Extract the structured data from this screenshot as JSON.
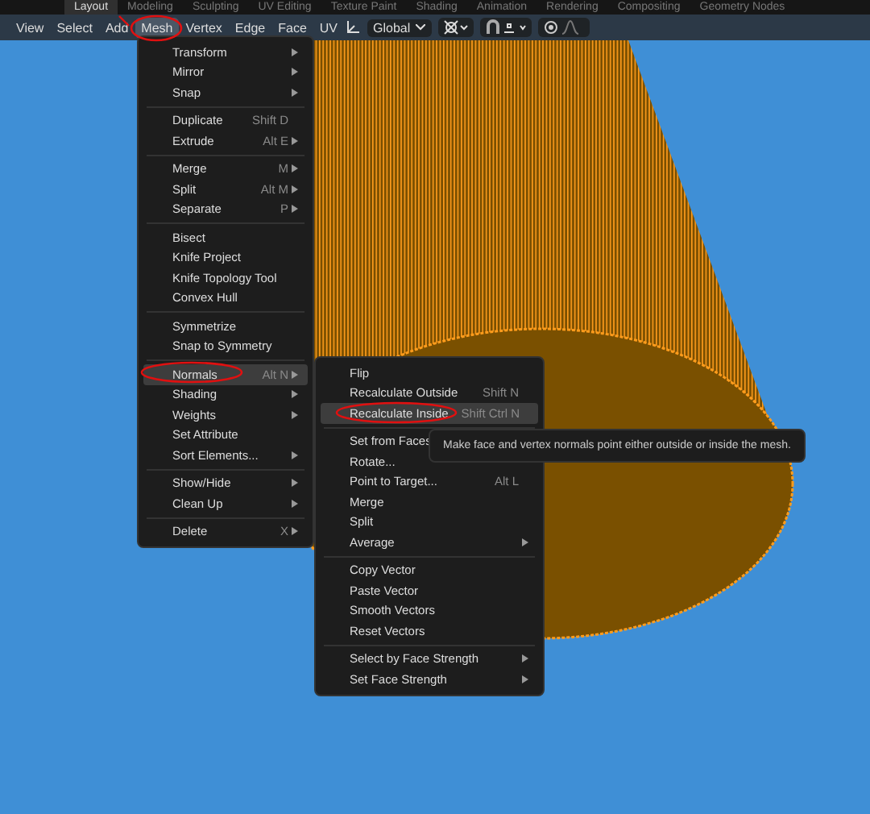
{
  "workspace_tabs": [
    {
      "label": "Layout",
      "selected": true
    },
    {
      "label": "Modeling",
      "selected": false
    },
    {
      "label": "Sculpting",
      "selected": false
    },
    {
      "label": "UV Editing",
      "selected": false
    },
    {
      "label": "Texture Paint",
      "selected": false
    },
    {
      "label": "Shading",
      "selected": false
    },
    {
      "label": "Animation",
      "selected": false
    },
    {
      "label": "Rendering",
      "selected": false
    },
    {
      "label": "Compositing",
      "selected": false
    },
    {
      "label": "Geometry Nodes",
      "selected": false
    }
  ],
  "header_menus": [
    {
      "label": "View",
      "selected": false
    },
    {
      "label": "Select",
      "selected": false
    },
    {
      "label": "Add",
      "selected": false
    },
    {
      "label": "Mesh",
      "selected": true
    },
    {
      "label": "Vertex",
      "selected": false
    },
    {
      "label": "Edge",
      "selected": false
    },
    {
      "label": "Face",
      "selected": false
    },
    {
      "label": "UV",
      "selected": false
    }
  ],
  "transform_orientation": {
    "value": "Global"
  },
  "mesh_menu": {
    "groups": [
      [
        {
          "label": "Transform",
          "submenu": true,
          "highlighted": false
        },
        {
          "label": "Mirror",
          "submenu": true,
          "highlighted": false
        },
        {
          "label": "Snap",
          "submenu": true,
          "highlighted": false
        }
      ],
      [
        {
          "label": "Duplicate",
          "shortcut": "Shift D",
          "submenu": false,
          "highlighted": false
        },
        {
          "label": "Extrude",
          "shortcut": "Alt E",
          "submenu": true,
          "highlighted": false
        }
      ],
      [
        {
          "label": "Merge",
          "shortcut": "M",
          "submenu": true,
          "highlighted": false
        },
        {
          "label": "Split",
          "shortcut": "Alt M",
          "submenu": true,
          "highlighted": false
        },
        {
          "label": "Separate",
          "shortcut": "P",
          "submenu": true,
          "highlighted": false
        }
      ],
      [
        {
          "label": "Bisect",
          "submenu": false,
          "highlighted": false
        },
        {
          "label": "Knife Project",
          "submenu": false,
          "highlighted": false
        },
        {
          "label": "Knife Topology Tool",
          "submenu": false,
          "highlighted": false
        },
        {
          "label": "Convex Hull",
          "submenu": false,
          "highlighted": false
        }
      ],
      [
        {
          "label": "Symmetrize",
          "submenu": false,
          "highlighted": false
        },
        {
          "label": "Snap to Symmetry",
          "submenu": false,
          "highlighted": false
        }
      ],
      [
        {
          "label": "Normals",
          "shortcut": "Alt N",
          "submenu": true,
          "highlighted": true
        },
        {
          "label": "Shading",
          "submenu": true,
          "highlighted": false
        },
        {
          "label": "Weights",
          "submenu": true,
          "highlighted": false
        },
        {
          "label": "Set Attribute",
          "submenu": false,
          "highlighted": false
        },
        {
          "label": "Sort Elements...",
          "submenu": true,
          "highlighted": false
        }
      ],
      [
        {
          "label": "Show/Hide",
          "submenu": true,
          "highlighted": false
        },
        {
          "label": "Clean Up",
          "submenu": true,
          "highlighted": false
        }
      ],
      [
        {
          "label": "Delete",
          "shortcut": "X",
          "submenu": true,
          "highlighted": false
        }
      ]
    ]
  },
  "normals_menu": {
    "groups": [
      [
        {
          "label": "Flip",
          "submenu": false,
          "highlighted": false
        },
        {
          "label": "Recalculate Outside",
          "shortcut": "Shift N",
          "submenu": false,
          "highlighted": false
        },
        {
          "label": "Recalculate Inside",
          "shortcut": "Shift Ctrl N",
          "submenu": false,
          "highlighted": true
        }
      ],
      [
        {
          "label": "Set from Faces",
          "submenu": false,
          "highlighted": false
        },
        {
          "label": "Rotate...",
          "submenu": false,
          "highlighted": false
        },
        {
          "label": "Point to Target...",
          "shortcut": "Alt L",
          "submenu": false,
          "highlighted": false
        },
        {
          "label": "Merge",
          "submenu": false,
          "highlighted": false
        },
        {
          "label": "Split",
          "submenu": false,
          "highlighted": false
        },
        {
          "label": "Average",
          "submenu": true,
          "highlighted": false
        }
      ],
      [
        {
          "label": "Copy Vector",
          "submenu": false,
          "highlighted": false
        },
        {
          "label": "Paste Vector",
          "submenu": false,
          "highlighted": false
        },
        {
          "label": "Smooth Vectors",
          "submenu": false,
          "highlighted": false
        },
        {
          "label": "Reset Vectors",
          "submenu": false,
          "highlighted": false
        }
      ],
      [
        {
          "label": "Select by Face Strength",
          "submenu": true,
          "highlighted": false
        },
        {
          "label": "Set Face Strength",
          "submenu": true,
          "highlighted": false
        }
      ]
    ]
  },
  "tooltip": {
    "text": "Make face and vertex normals point either outside or inside the mesh."
  }
}
